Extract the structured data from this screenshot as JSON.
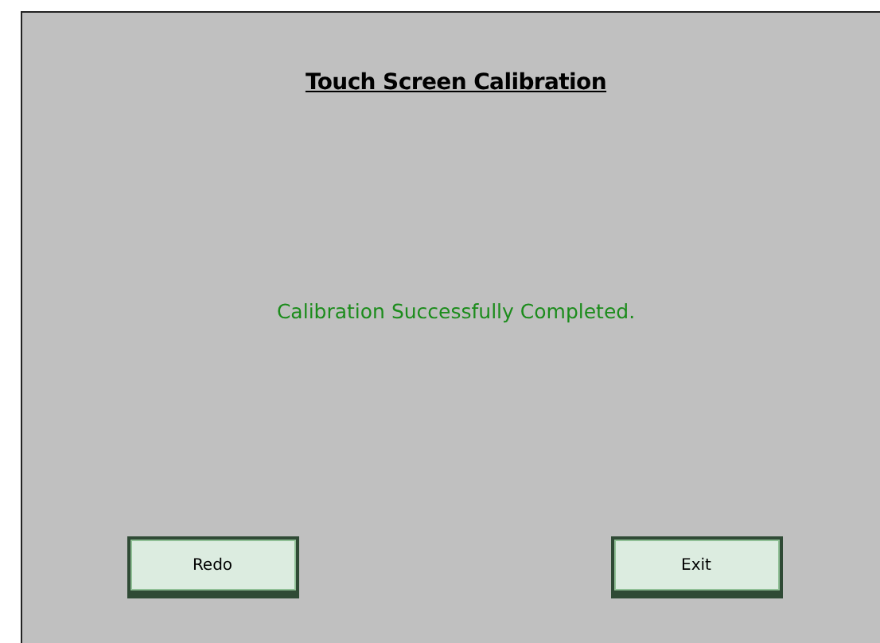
{
  "title": "Touch Screen Calibration",
  "message": "Calibration Successfully Completed.",
  "buttons": [
    {
      "label": "Redo"
    },
    {
      "label": "Exit"
    }
  ]
}
